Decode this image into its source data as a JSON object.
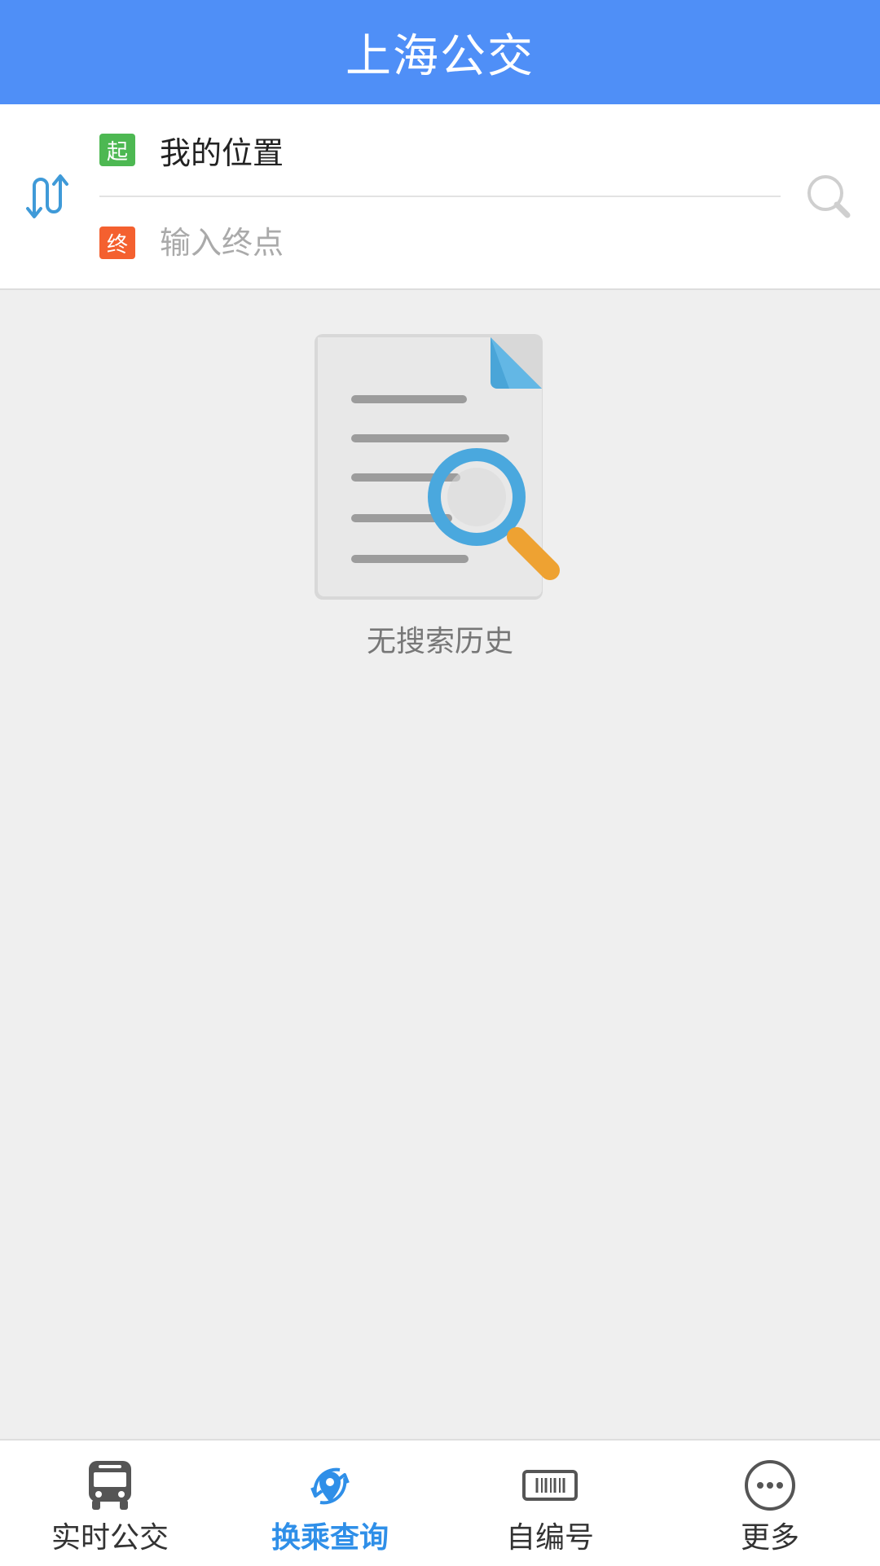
{
  "header": {
    "title": "上海公交"
  },
  "route": {
    "start_badge": "起",
    "start_value": "我的位置",
    "end_badge": "终",
    "end_placeholder": "输入终点",
    "swap_icon": "swap-route-icon",
    "search_icon": "search-icon"
  },
  "empty_state": {
    "message": "无搜索历史",
    "icon": "document-search-icon"
  },
  "bottom_nav": {
    "items": [
      {
        "label": "实时公交",
        "icon": "bus-icon",
        "active": false
      },
      {
        "label": "换乘查询",
        "icon": "transfer-location-icon",
        "active": true
      },
      {
        "label": "自编号",
        "icon": "barcode-card-icon",
        "active": false
      },
      {
        "label": "更多",
        "icon": "more-icon",
        "active": false
      }
    ]
  },
  "colors": {
    "header": "#4f8ff7",
    "active_tab": "#2f8fe8",
    "start_badge": "#4db852",
    "end_badge": "#f4602f"
  }
}
